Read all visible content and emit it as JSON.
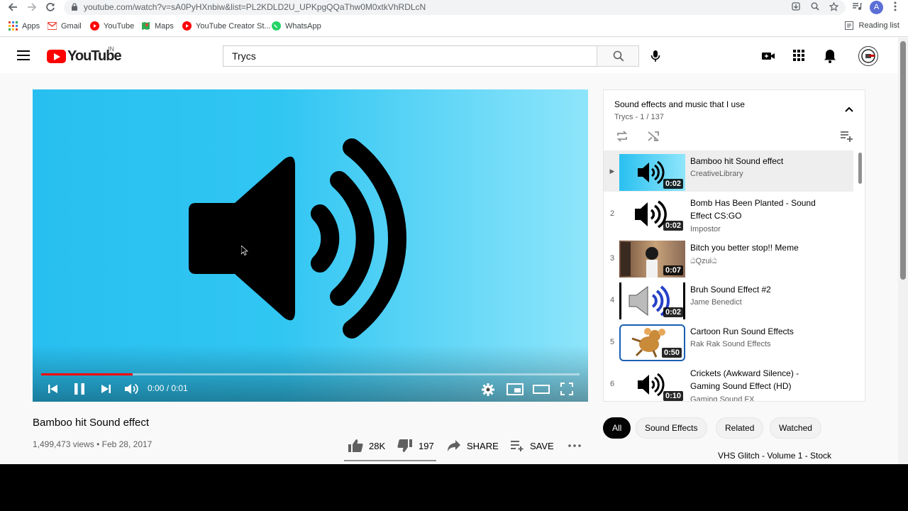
{
  "browser": {
    "url": "youtube.com/watch?v=sA0PyHXnbiw&list=PL2KDLD2U_UPKpgQQaThw0M0xtkVhRDLcN",
    "profile_initial": "A",
    "bookmarks": [
      {
        "label": "Apps",
        "icon": "apps-grid-icon",
        "color": "#ea4335"
      },
      {
        "label": "Gmail",
        "icon": "gmail-icon",
        "color": "#ea4335"
      },
      {
        "label": "YouTube",
        "icon": "youtube-icon",
        "color": "#ff0000"
      },
      {
        "label": "Maps",
        "icon": "maps-icon",
        "color": "#34a853"
      },
      {
        "label": "YouTube Creator St...",
        "icon": "youtube-icon",
        "color": "#ff0000"
      },
      {
        "label": "WhatsApp",
        "icon": "whatsapp-icon",
        "color": "#25d366"
      }
    ],
    "reading_list": "Reading list"
  },
  "header": {
    "logo_text": "YouTube",
    "country_code": "IN",
    "search_value": "Trycs"
  },
  "player": {
    "time": "0:00 / 0:01",
    "progress_fraction": 0.17,
    "state": "playing"
  },
  "video": {
    "title": "Bamboo hit Sound effect",
    "views": "1,499,473 views",
    "date": "Feb 28, 2017",
    "likes": "28K",
    "dislikes": "197",
    "share_label": "SHARE",
    "save_label": "SAVE"
  },
  "playlist": {
    "title": "Sound effects and music that I use",
    "subtitle": "Trycs - 1 / 137",
    "items": [
      {
        "index": "▶",
        "title": "Bamboo hit Sound effect",
        "channel": "CreativeLibrary",
        "duration": "0:02",
        "thumb": "speaker-cyan"
      },
      {
        "index": "2",
        "title": "Bomb Has Been Planted - Sound Effect CS:GO",
        "channel": "Impostor",
        "duration": "0:02",
        "thumb": "speaker-white"
      },
      {
        "index": "3",
        "title": "Bitch you better stop!! Meme",
        "channel": "ඨQzuiඨ",
        "duration": "0:07",
        "thumb": "meme"
      },
      {
        "index": "4",
        "title": "Bruh Sound Effect #2",
        "channel": "Jame Benedict",
        "duration": "0:02",
        "thumb": "speaker-blue"
      },
      {
        "index": "5",
        "title": "Cartoon Run Sound Effects",
        "channel": "Rak Rak Sound Effects",
        "duration": "0:50",
        "thumb": "cartoon"
      },
      {
        "index": "6",
        "title": "Crickets (Awkward Silence) - Gaming Sound Effect (HD)",
        "channel": "Gaming Sound FX",
        "duration": "0:10",
        "thumb": "speaker-white"
      }
    ]
  },
  "chips": [
    "All",
    "Sound Effects",
    "Related",
    "Watched"
  ],
  "next_title": "VHS Glitch - Volume 1 - Stock"
}
